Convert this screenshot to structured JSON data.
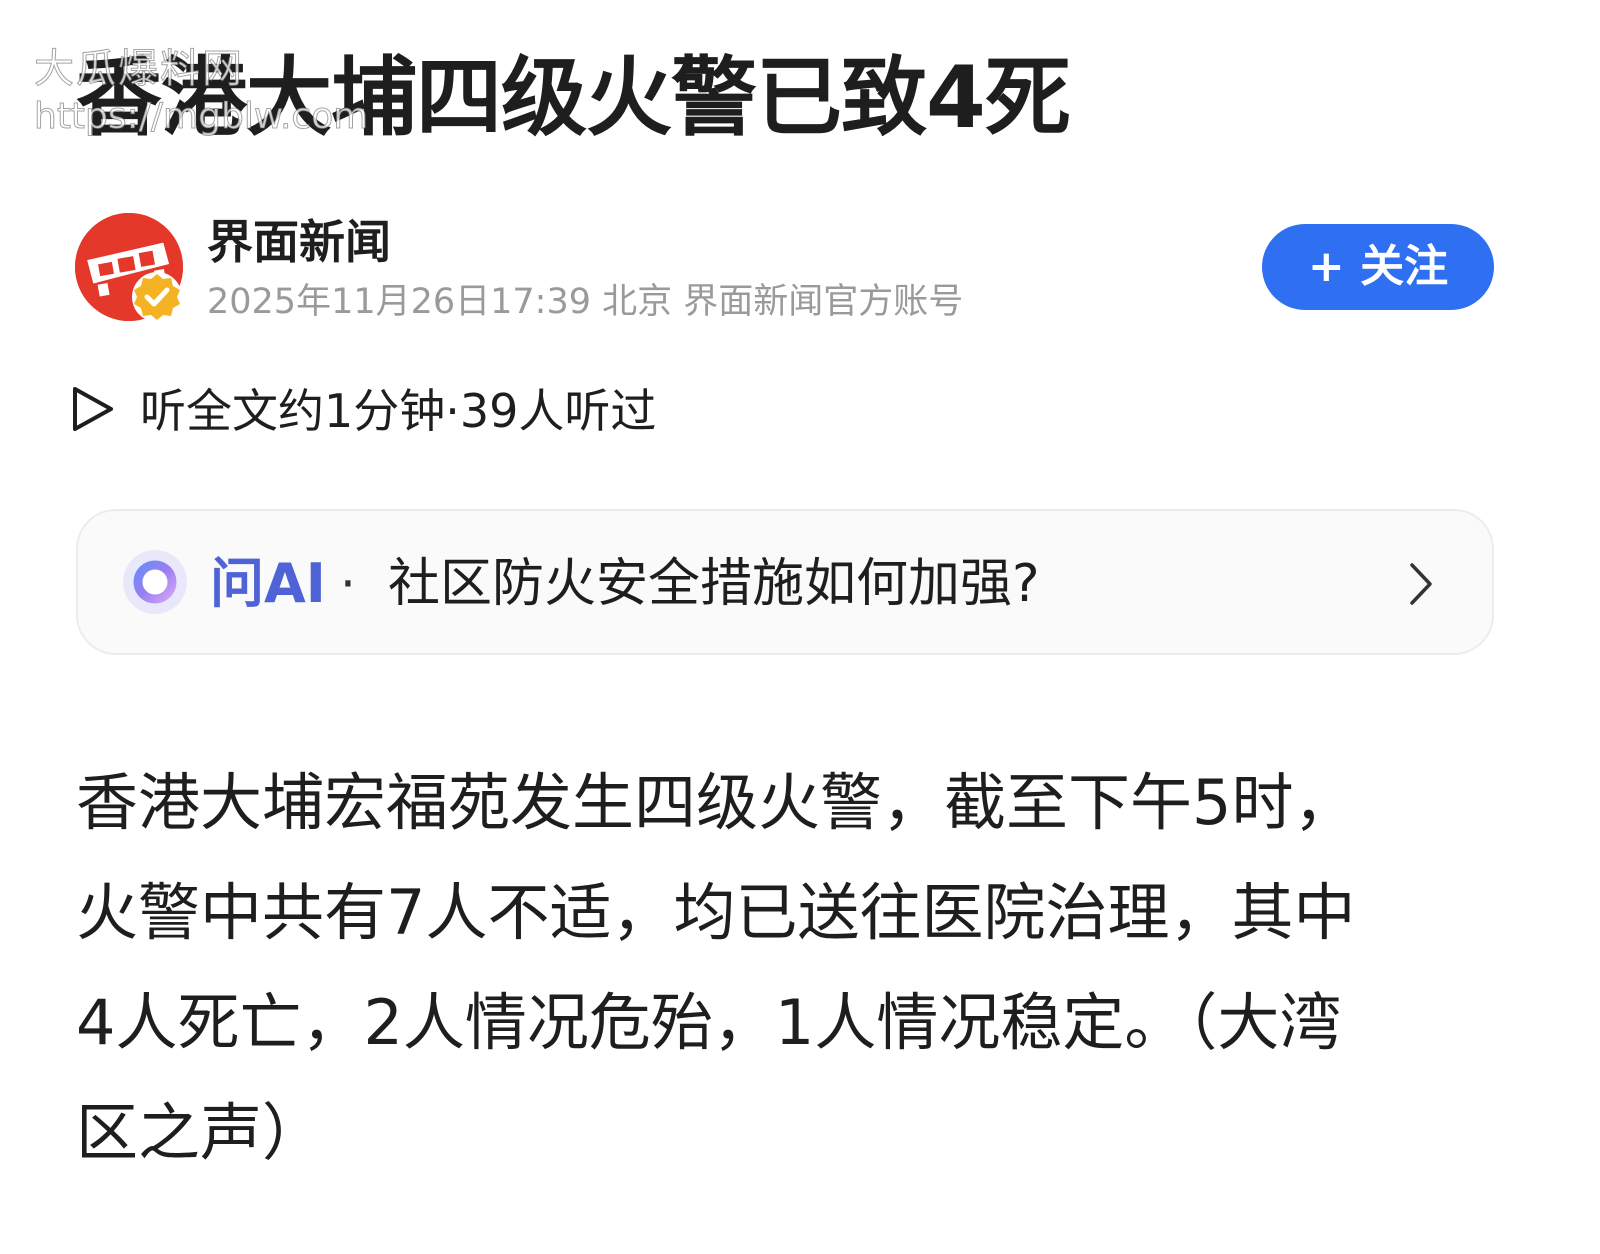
{
  "article": {
    "headline": "香港大埔四级火警已致4死",
    "watermark": {
      "title": "大瓜爆料网",
      "url": "https://mgblw.com"
    },
    "author": {
      "name": "界面新闻",
      "meta": "2025年11月26日17:39 北京 界面新闻官方账号",
      "verified_color": "#f5b324",
      "avatar_color": "#e4382b"
    },
    "follow_button": {
      "label": "+ 关注",
      "color": "#2f6ff2"
    },
    "listen": {
      "icon": "play-icon",
      "text": "听全文约1分钟·39人听过"
    },
    "ask_ai": {
      "icon": "ai-ring-icon",
      "label": "问AI",
      "separator": "·",
      "question": "社区防火安全措施如何加强?",
      "accent": "#4f63d6"
    },
    "body_lines": [
      "香港大埔宏福苑发生四级火警，截至下午5时，",
      "火警中共有7人不适，均已送往医院治理，其中",
      "4人死亡，2人情况危殆，1人情况稳定。（大湾",
      "区之声）"
    ]
  }
}
